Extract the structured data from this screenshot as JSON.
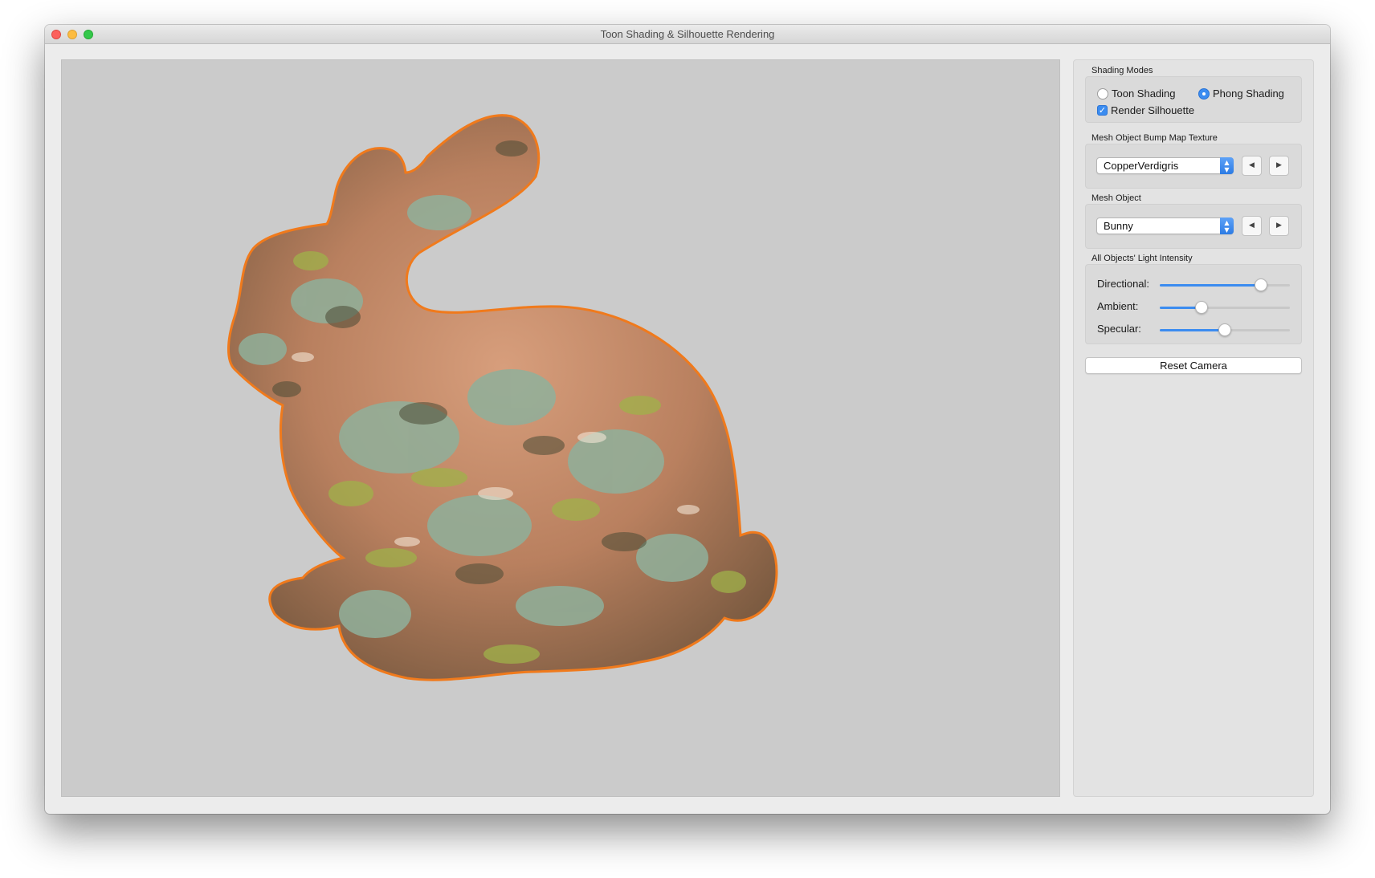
{
  "window": {
    "title": "Toon Shading & Silhouette Rendering"
  },
  "panel": {
    "shading": {
      "label": "Shading Modes",
      "toon_label": "Toon Shading",
      "phong_label": "Phong Shading",
      "silhouette_label": "Render Silhouette",
      "selected": "Phong Shading",
      "silhouette_checked": true
    },
    "texture": {
      "label": "Mesh Object Bump Map Texture",
      "selected": "CopperVerdigris"
    },
    "mesh": {
      "label": "Mesh Object",
      "selected": "Bunny"
    },
    "light": {
      "label": "All Objects' Light Intensity",
      "sliders": [
        {
          "label": "Directional:",
          "value": 0.78
        },
        {
          "label": "Ambient:",
          "value": 0.32
        },
        {
          "label": "Specular:",
          "value": 0.5
        }
      ]
    },
    "reset_label": "Reset Camera"
  },
  "colors": {
    "accent": "#3b8cf0",
    "silhouette": "#f07a1c",
    "copper": "#c98e6e",
    "verdigris": "#8fb5a0",
    "viewport_bg": "#cbcbcb"
  },
  "icons": {
    "prev": "triangle-left-icon",
    "next": "triangle-right-icon",
    "dropdown": "updown-chevron-icon"
  }
}
